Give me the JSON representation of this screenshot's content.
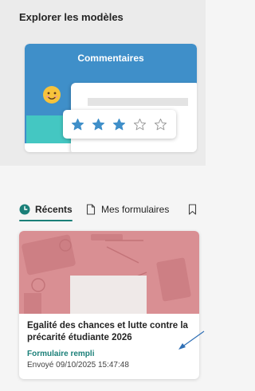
{
  "explore": {
    "title": "Explorer les modèles"
  },
  "template": {
    "title": "Commentaires",
    "rating_filled": 3,
    "rating_max": 5
  },
  "tabs": [
    {
      "label": "Récents",
      "icon": "clock-icon",
      "selected": true
    },
    {
      "label": "Mes formulaires",
      "icon": "document-icon",
      "selected": false
    },
    {
      "label": "",
      "icon": "bookmark-icon",
      "selected": false
    }
  ],
  "recent_form": {
    "title": "Egalité des chances et lutte contre la précarité étudiante 2026",
    "status": "Formulaire rempli",
    "sent": "Envoyé 09/10/2025 15:47:48"
  },
  "colors": {
    "accent": "#1a7f78",
    "template_blue": "#3f8fc9",
    "template_teal": "#44c7c2",
    "star": "#3f8fc9",
    "cover_pink": "#d98f93",
    "arrow": "#2f6fb5"
  }
}
